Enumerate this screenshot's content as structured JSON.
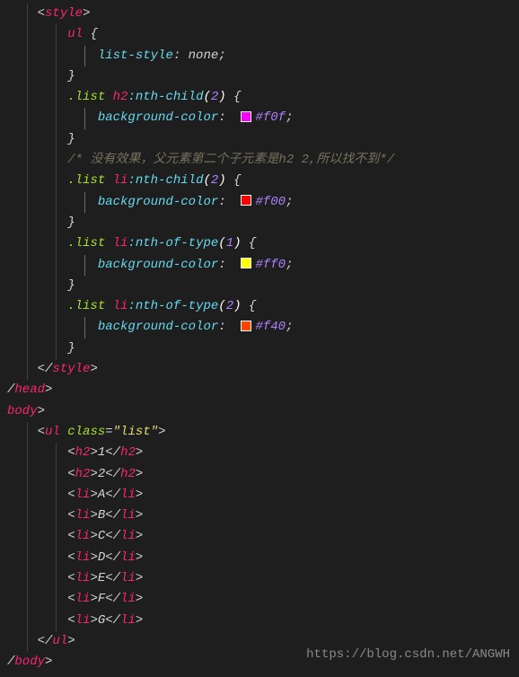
{
  "lines": [
    {
      "indent": 1,
      "open_tag": "style"
    },
    {
      "indent": 2,
      "selector_parts": [
        {
          "t": "elem",
          "v": "ul"
        }
      ],
      "brace": "{"
    },
    {
      "indent": 3,
      "prop": "list-style",
      "value_text": "none",
      "semicolon": true
    },
    {
      "indent": 2,
      "brace": "}"
    },
    {
      "indent": 2,
      "selector_parts": [
        {
          "t": "class",
          "v": ".list"
        },
        {
          "t": "space",
          "v": " "
        },
        {
          "t": "elem",
          "v": "h2"
        },
        {
          "t": "pseudo-fn",
          "v": ":nth-child"
        },
        {
          "t": "paren",
          "v": "("
        },
        {
          "t": "num",
          "v": "2"
        },
        {
          "t": "paren",
          "v": ")"
        }
      ],
      "brace": "{"
    },
    {
      "indent": 3,
      "prop": "background-color",
      "swatch": "#f0f",
      "color_val": "#f0f",
      "semicolon": true
    },
    {
      "indent": 2,
      "brace": "}"
    },
    {
      "indent": 2,
      "comment": "/* 没有效果，父元素第二个子元素是h2 2,所以找不到*/"
    },
    {
      "indent": 2,
      "selector_parts": [
        {
          "t": "class",
          "v": ".list"
        },
        {
          "t": "space",
          "v": " "
        },
        {
          "t": "elem",
          "v": "li"
        },
        {
          "t": "pseudo-fn",
          "v": ":nth-child"
        },
        {
          "t": "paren",
          "v": "("
        },
        {
          "t": "num",
          "v": "2"
        },
        {
          "t": "paren",
          "v": ")"
        }
      ],
      "brace": "{"
    },
    {
      "indent": 3,
      "prop": "background-color",
      "swatch": "#f00",
      "color_val": "#f00",
      "semicolon": true
    },
    {
      "indent": 2,
      "brace": "}"
    },
    {
      "indent": 2,
      "selector_parts": [
        {
          "t": "class",
          "v": ".list"
        },
        {
          "t": "space",
          "v": " "
        },
        {
          "t": "elem",
          "v": "li"
        },
        {
          "t": "pseudo-fn",
          "v": ":nth-of-type"
        },
        {
          "t": "paren",
          "v": "("
        },
        {
          "t": "num",
          "v": "1"
        },
        {
          "t": "paren",
          "v": ")"
        }
      ],
      "brace": "{"
    },
    {
      "indent": 3,
      "prop": "background-color",
      "swatch": "#ff0",
      "color_val": "#ff0",
      "semicolon": true
    },
    {
      "indent": 2,
      "brace": "}"
    },
    {
      "indent": 2,
      "selector_parts": [
        {
          "t": "class",
          "v": ".list"
        },
        {
          "t": "space",
          "v": " "
        },
        {
          "t": "elem",
          "v": "li"
        },
        {
          "t": "pseudo-fn",
          "v": ":nth-of-type"
        },
        {
          "t": "paren",
          "v": "("
        },
        {
          "t": "num",
          "v": "2"
        },
        {
          "t": "paren",
          "v": ")"
        }
      ],
      "brace": "{"
    },
    {
      "indent": 3,
      "prop": "background-color",
      "swatch": "#f40",
      "color_val": "#f40",
      "semicolon": true
    },
    {
      "indent": 2,
      "brace": "}"
    },
    {
      "indent": 1,
      "close_tag": "style"
    },
    {
      "indent": 0,
      "close_tag_partial": "head"
    },
    {
      "indent": 0,
      "open_tag_partial": "body"
    },
    {
      "indent": 1,
      "open_tag_attr": {
        "tag": "ul",
        "attr": "class",
        "val": "list"
      }
    },
    {
      "indent": 2,
      "inline_tag": {
        "tag": "h2",
        "content": "1"
      }
    },
    {
      "indent": 2,
      "inline_tag": {
        "tag": "h2",
        "content": "2"
      }
    },
    {
      "indent": 2,
      "inline_tag": {
        "tag": "li",
        "content": "A"
      }
    },
    {
      "indent": 2,
      "inline_tag": {
        "tag": "li",
        "content": "B"
      }
    },
    {
      "indent": 2,
      "inline_tag": {
        "tag": "li",
        "content": "C"
      }
    },
    {
      "indent": 2,
      "inline_tag": {
        "tag": "li",
        "content": "D"
      }
    },
    {
      "indent": 2,
      "inline_tag": {
        "tag": "li",
        "content": "E"
      }
    },
    {
      "indent": 2,
      "inline_tag": {
        "tag": "li",
        "content": "F"
      }
    },
    {
      "indent": 2,
      "inline_tag": {
        "tag": "li",
        "content": "G"
      }
    },
    {
      "indent": 1,
      "close_tag": "ul"
    },
    {
      "indent": 0,
      "close_tag_partial": "body"
    }
  ],
  "watermark": "https://blog.csdn.net/ANGWH"
}
